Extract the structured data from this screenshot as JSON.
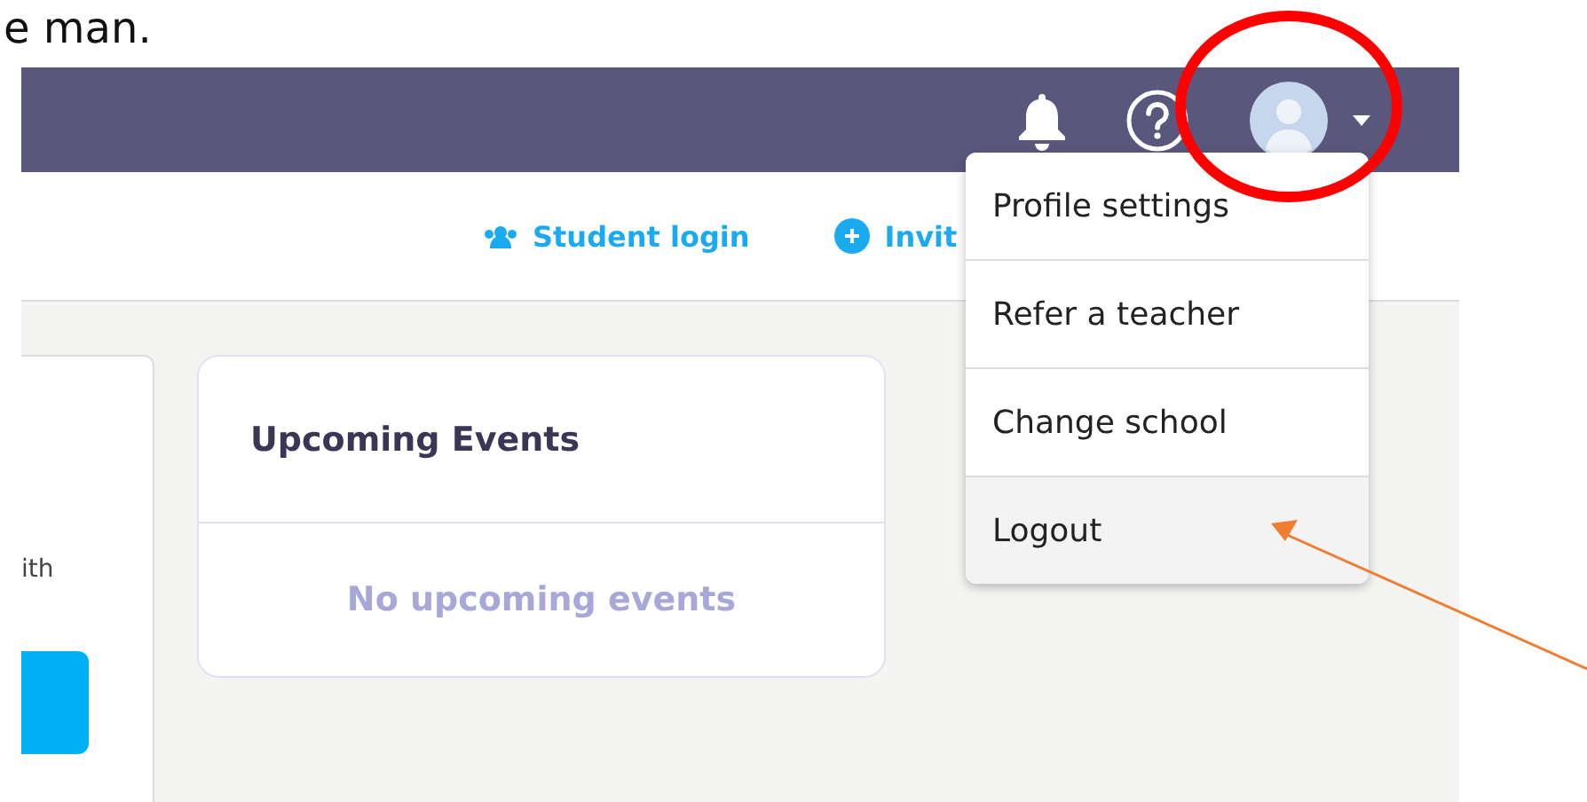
{
  "caption": "e man.",
  "header_links": [
    {
      "label": "Student login",
      "kind": "students"
    },
    {
      "label": "Invit",
      "kind": "plus"
    }
  ],
  "left_card": {
    "text": "ith"
  },
  "events_card": {
    "title": "Upcoming Events",
    "empty_text": "No upcoming events"
  },
  "account_menu": {
    "expanded": true,
    "items": [
      {
        "label": "Profile settings",
        "selected": false
      },
      {
        "label": "Refer a teacher",
        "selected": false
      },
      {
        "label": "Change school",
        "selected": false
      },
      {
        "label": "Logout",
        "selected": true
      }
    ]
  }
}
